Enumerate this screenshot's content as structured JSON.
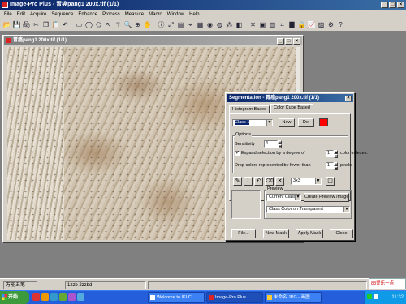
{
  "app": {
    "title": "Image-Pro Plus - 胃癌pang1 200x.tif (1/1)",
    "title_buttons": [
      "_",
      "□",
      "×"
    ]
  },
  "menu": [
    "File",
    "Edit",
    "Acquire",
    "Sequence",
    "Enhance",
    "Process",
    "Measure",
    "Macro",
    "Window",
    "Help"
  ],
  "toolbar": [
    {
      "icon": "folder-open-icon",
      "glyph": "📂"
    },
    {
      "icon": "save-icon",
      "glyph": "💾"
    },
    {
      "icon": "print-icon",
      "glyph": "🖨"
    },
    {
      "icon": "scissors-icon",
      "glyph": "✂"
    },
    {
      "icon": "copy-icon",
      "glyph": "❐"
    },
    {
      "icon": "paste-icon",
      "glyph": "📋"
    },
    {
      "icon": "undo-icon",
      "glyph": "↶"
    },
    {
      "icon": "rectangle-aoi-icon",
      "glyph": "▭"
    },
    {
      "icon": "ellipse-aoi-icon",
      "glyph": "◯"
    },
    {
      "icon": "polygon-aoi-icon",
      "glyph": "⬠"
    },
    {
      "icon": "select-arrow-icon",
      "glyph": "↖"
    },
    {
      "icon": "magic-wand-icon",
      "glyph": "⚚"
    },
    {
      "icon": "zoom-icon",
      "glyph": "🔍"
    },
    {
      "icon": "zoom-in-icon",
      "glyph": "⊕"
    },
    {
      "icon": "pan-hand-icon",
      "glyph": "✋"
    },
    {
      "icon": "info-icon",
      "glyph": "ⓘ"
    },
    {
      "icon": "zoom-fit-icon",
      "glyph": "⤢"
    },
    {
      "icon": "sequence-icon",
      "glyph": "▤"
    },
    {
      "icon": "measure-icon",
      "glyph": "⌖"
    },
    {
      "icon": "grid-icon",
      "glyph": "▦"
    },
    {
      "icon": "filter-icon",
      "glyph": "◉"
    },
    {
      "icon": "color-icon",
      "glyph": "◍"
    },
    {
      "icon": "count-icon",
      "glyph": "⁂"
    },
    {
      "icon": "shading-icon",
      "glyph": "◧"
    },
    {
      "icon": "close-doc-icon",
      "glyph": "✕"
    },
    {
      "icon": "threshold-icon",
      "glyph": "▣"
    },
    {
      "icon": "segmentation-icon",
      "glyph": "▥"
    },
    {
      "icon": "calibration-icon",
      "glyph": "⌗"
    },
    {
      "icon": "histogram-icon",
      "glyph": "▇"
    },
    {
      "icon": "lock-icon",
      "glyph": "🔒"
    },
    {
      "icon": "line-profile-icon",
      "glyph": "📈"
    },
    {
      "icon": "bitmap-icon",
      "glyph": "▨"
    },
    {
      "icon": "macro-icon",
      "glyph": "⚙"
    },
    {
      "icon": "help-icon",
      "glyph": "?"
    }
  ],
  "image_window": {
    "title": "胃癌pang1 200x.tif (1/1)",
    "buttons": [
      "_",
      "□",
      "×"
    ]
  },
  "segmentation": {
    "title": "Segmentation - 胃癌pang1 200x.tif (1/1)",
    "close_glyph": "×",
    "tabs": [
      "Histogram Based",
      "Color Cube Based"
    ],
    "class_value": "Class 1",
    "new_label": "New",
    "del_label": "Del",
    "class_color": "#ff0000",
    "options_title": "Options",
    "sensitivity_label": "Sensitivity",
    "sensitivity_value": "4",
    "expand_checked": true,
    "expand_label": "Expand selection by a degree of",
    "expand_value": "1",
    "expand_unit": "color indexes.",
    "drop_label": "Drop colors represented by fewer than",
    "drop_value": "1",
    "drop_unit": "pixels.",
    "tools": [
      {
        "icon": "pencil-tool-icon",
        "glyph": "✎"
      },
      {
        "icon": "eyedropper-tool-icon",
        "glyph": "⌇"
      },
      {
        "icon": "undo-tool-icon",
        "glyph": "↶"
      },
      {
        "icon": "eraser-tool-icon",
        "glyph": "⌫"
      },
      {
        "icon": "cross-tool-icon",
        "glyph": "✕"
      }
    ],
    "kernel_value": "3x3",
    "kernel_icon_glyph": "◫",
    "preview_title": "Preview",
    "preview_value": "Current Class",
    "create_preview_label": "Create Preview Image",
    "overlay_value": "Class Color on Transparent",
    "buttons": {
      "file": "File...",
      "new_mask": "New Mask",
      "apply_mask": "Apply Mask",
      "close": "Close"
    }
  },
  "status": {
    "coords": "1zzb 2zzbd"
  },
  "taskbar": {
    "start_label": "开始",
    "tasks": [
      {
        "label": "Welcome to IKI.C..."
      },
      {
        "label": "Image-Pro Plus ..."
      },
      {
        "label": "未命名.JPG - 画图"
      }
    ],
    "tray_mini_label": "万能五笔",
    "ime_label": "88爱乐一点",
    "clock": "11:32"
  },
  "colors": {
    "title_active": "#0a246a",
    "title_inactive": "#808080",
    "face": "#d4d0c8",
    "taskbar": "#245edb",
    "start": "#3c9a3c"
  }
}
